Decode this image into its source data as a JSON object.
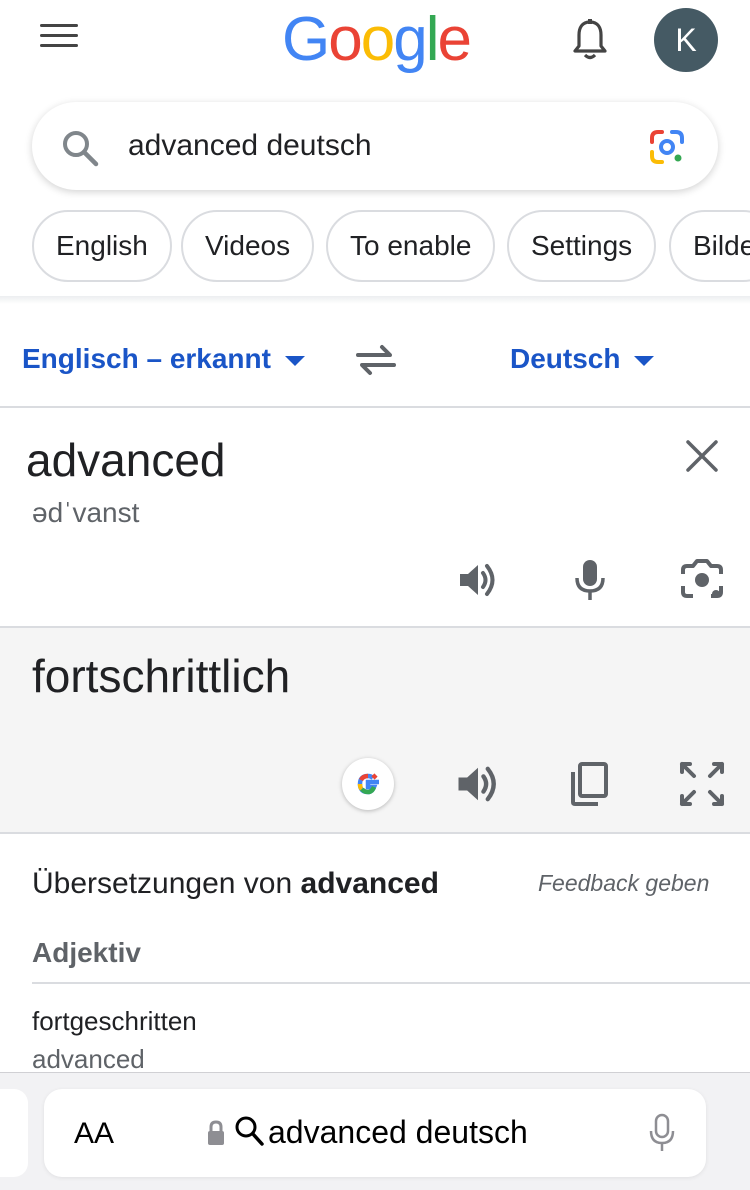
{
  "header": {
    "logo": [
      "G",
      "o",
      "o",
      "g",
      "l",
      "e"
    ],
    "avatar_initial": "K"
  },
  "search": {
    "query": "advanced deutsch"
  },
  "chips": [
    "English",
    "Videos",
    "To enable",
    "Settings",
    "Bilde"
  ],
  "translate": {
    "source_lang": "Englisch – erkannt",
    "target_lang": "Deutsch",
    "source_text": "advanced",
    "phonetic": "ədˈvanst",
    "target_text": "fortschrittlich"
  },
  "translations": {
    "title_prefix": "Übersetzungen von ",
    "title_word": "advanced",
    "feedback": "Feedback geben",
    "part_of_speech": "Adjektiv",
    "entries": [
      {
        "word": "fortgeschritten",
        "back": "advanced"
      }
    ]
  },
  "browser": {
    "text_size": "AA",
    "address": "advanced deutsch"
  },
  "colors": {
    "link_blue": "#1a55c7",
    "avatar_bg": "#455a64",
    "panel_bg": "#f5f5f5"
  }
}
